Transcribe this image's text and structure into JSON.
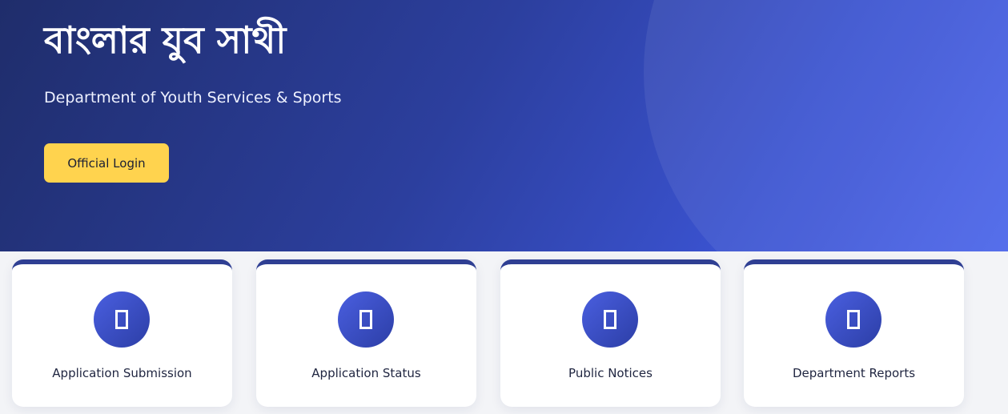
{
  "hero": {
    "title": "বাংলার যুব সাথী",
    "subtitle": "Department of Youth Services & Sports",
    "login_button": "Official Login"
  },
  "colors": {
    "hero_dark": "#1f2d6b",
    "hero_light": "#4a64ea",
    "login_button_bg": "#ffd34e",
    "card_accent": "#2f3f93"
  },
  "cards": [
    {
      "label": "Application Submission",
      "icon": "missing-glyph-icon"
    },
    {
      "label": "Application Status",
      "icon": "missing-glyph-icon"
    },
    {
      "label": "Public Notices",
      "icon": "missing-glyph-icon"
    },
    {
      "label": "Department Reports",
      "icon": "missing-glyph-icon"
    }
  ]
}
